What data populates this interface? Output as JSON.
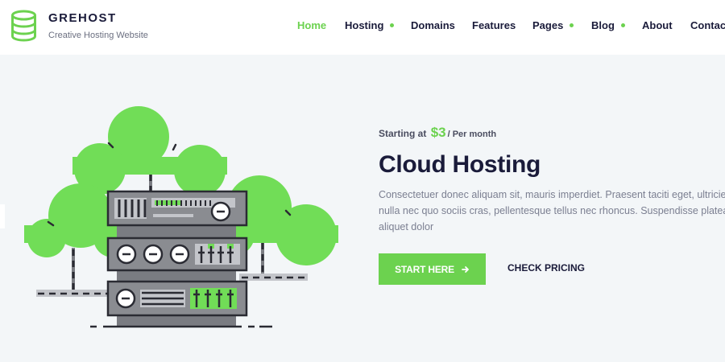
{
  "header": {
    "brand": "GREHOST",
    "tagline": "Creative Hosting Website",
    "nav": [
      {
        "label": "Home",
        "active": true,
        "has_submenu": false
      },
      {
        "label": "Hosting",
        "active": false,
        "has_submenu": true
      },
      {
        "label": "Domains",
        "active": false,
        "has_submenu": false
      },
      {
        "label": "Features",
        "active": false,
        "has_submenu": false
      },
      {
        "label": "Pages",
        "active": false,
        "has_submenu": true
      },
      {
        "label": "Blog",
        "active": false,
        "has_submenu": true
      },
      {
        "label": "About",
        "active": false,
        "has_submenu": false
      },
      {
        "label": "Contact",
        "active": false,
        "has_submenu": false
      }
    ]
  },
  "hero": {
    "pretitle_prefix": "Starting at",
    "price": "$3",
    "price_suffix": "/ Per month",
    "title": "Cloud Hosting",
    "description": "Consectetuer donec aliquam sit, mauris imperdiet. Praesent taciti eget, ultricies nulla nec quo sociis cras, pellentesque tellus nec rhoncus. Suspendisse platea aliquet dolor",
    "primary_button": "START HERE",
    "secondary_button": "CHECK PRICING"
  },
  "icons": {
    "logo": "database-icon",
    "primary_button_icon": "arrow-right-icon",
    "submenu_indicator": "dot-icon"
  },
  "colors": {
    "accent": "#6cd24f",
    "dark": "#1a1b3a",
    "background": "#f3f6f8",
    "server_body": "#8a8c91"
  }
}
